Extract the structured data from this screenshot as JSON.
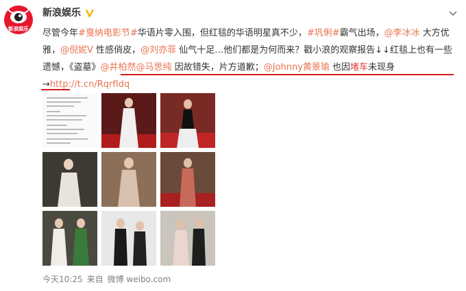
{
  "account": {
    "name": "新浪娱乐",
    "avatar_text": "新浪娱乐",
    "verified_icon": "verified-v-icon"
  },
  "post": {
    "seg1": "尽管今年",
    "tag1": "#戛纳电影节#",
    "seg2": "华语片零入围，但红毯的华语明星真不少，",
    "tag2": "#巩俐#",
    "seg3": "霸气出场，",
    "m1": "@李冰冰",
    "seg4": " 大方优雅，",
    "m2": "@倪妮V",
    "seg5": " 性感俏皮，",
    "m3": "@刘亦菲",
    "seg6": " 仙气十足…他们都是为何而来？戳小浪的观察报告↓↓红毯上也有一些遗憾，",
    "film": "《盗墓》",
    "m4": "@井柏然",
    "m5": "@马思纯",
    "seg7": " 因故错失，片方道歉；",
    "m6": "@Johnny黄景瑜",
    "seg8": " 也因",
    "jam": "堵车",
    "seg9": "未现身→",
    "link": "http://t.cn/RqrfIdq"
  },
  "footer": {
    "time": "今天10:25",
    "source_prefix": "来自",
    "source": "微博 weibo.com"
  },
  "icons": {
    "menu": "chevron-down-icon",
    "link": "link-arrow-icon"
  },
  "colors": {
    "link": "#eb7350",
    "underline": "#d51d1d",
    "verified": "#f7b500"
  }
}
